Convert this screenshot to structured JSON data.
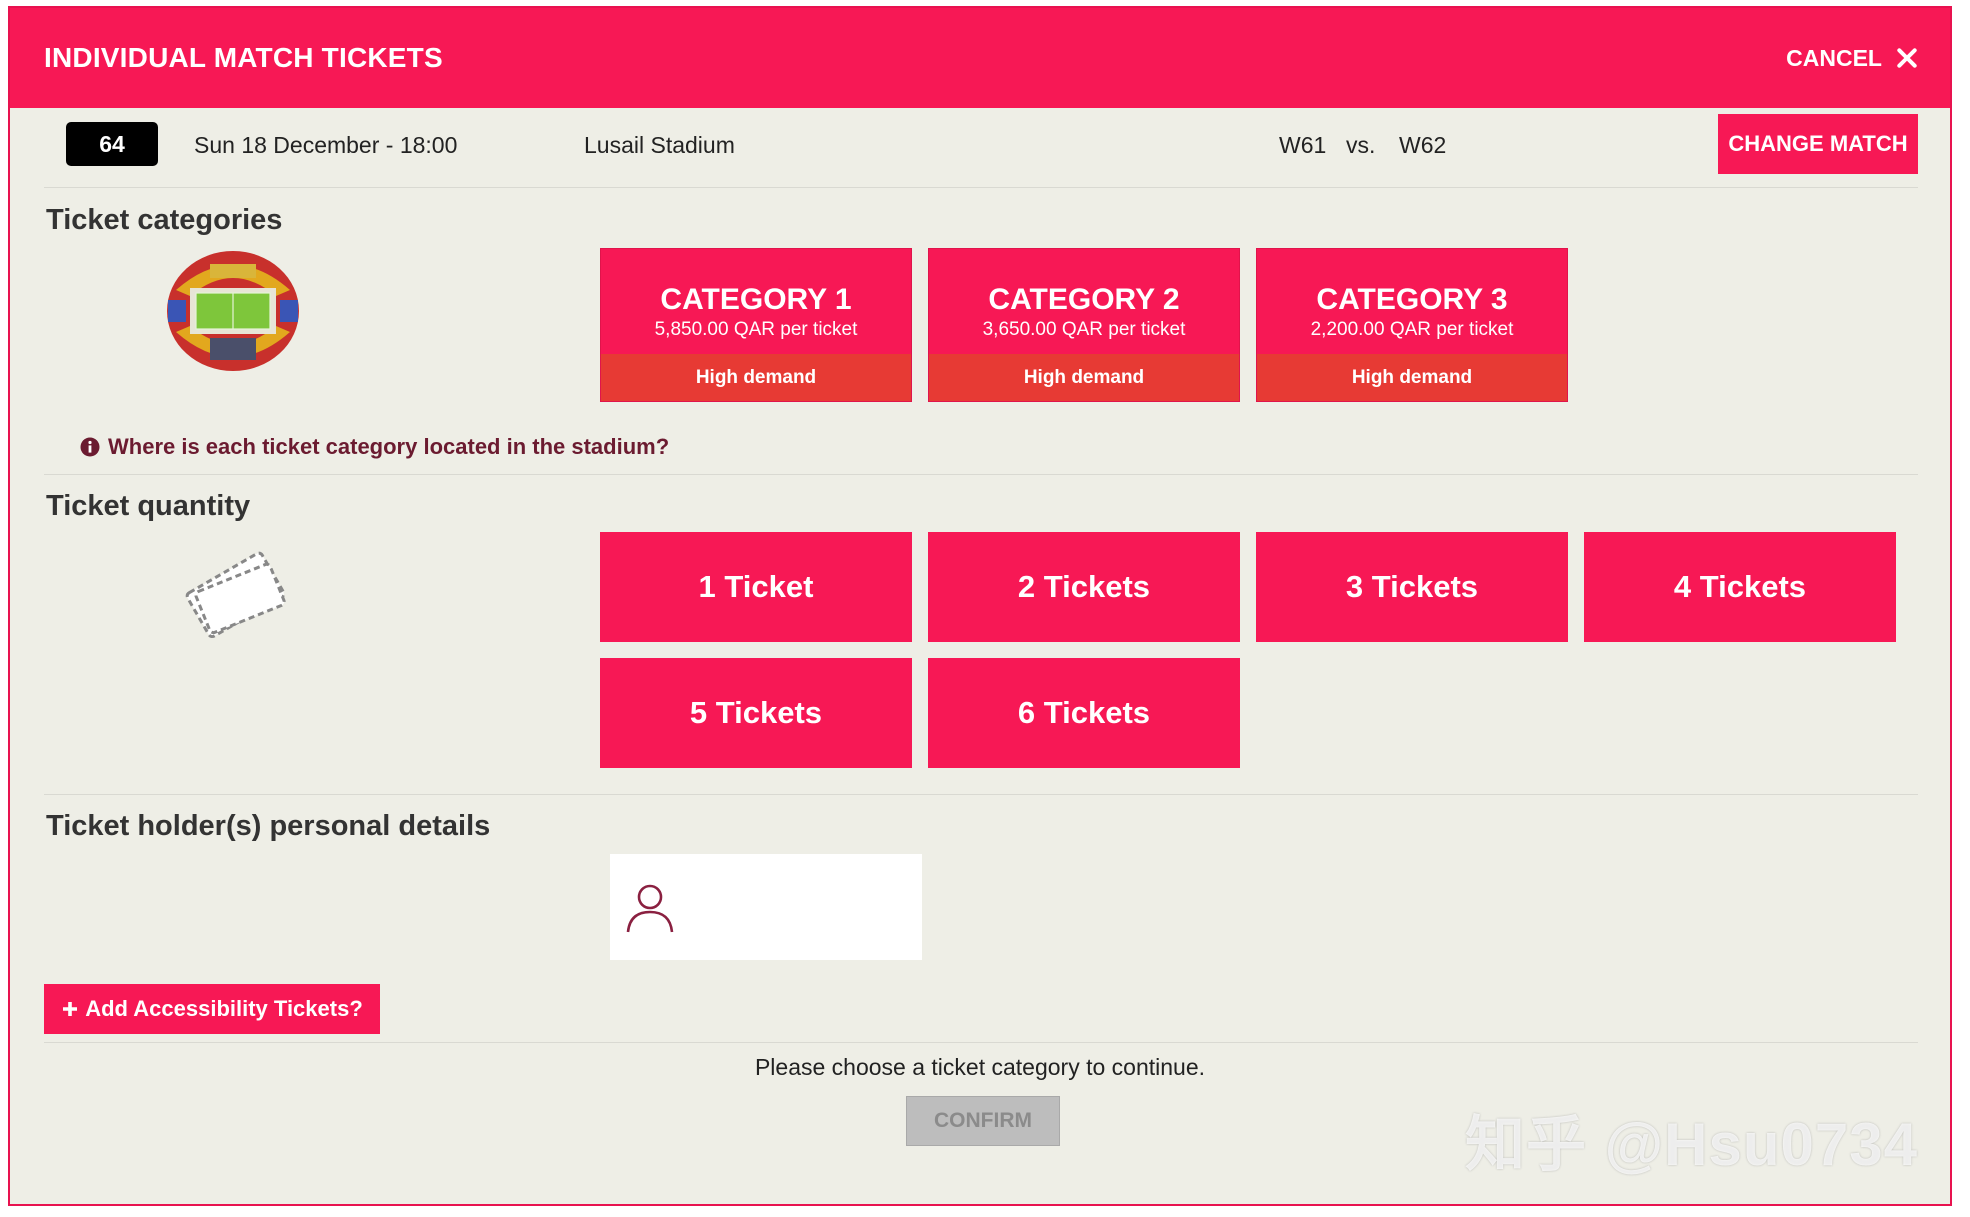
{
  "header": {
    "title": "INDIVIDUAL MATCH TICKETS",
    "cancel_label": "CANCEL"
  },
  "match": {
    "number": "64",
    "date": "Sun 18 December - 18:00",
    "venue": "Lusail Stadium",
    "home": "W61",
    "vs": "vs.",
    "away": "W62",
    "change_label": "CHANGE MATCH"
  },
  "categories": {
    "title": "Ticket categories",
    "items": [
      {
        "name": "CATEGORY 1",
        "price": "5,850.00 QAR per ticket",
        "demand": "High demand"
      },
      {
        "name": "CATEGORY 2",
        "price": "3,650.00 QAR per ticket",
        "demand": "High demand"
      },
      {
        "name": "CATEGORY 3",
        "price": "2,200.00 QAR per ticket",
        "demand": "High demand"
      }
    ],
    "where_link": "Where is each ticket category located in the stadium?"
  },
  "quantity": {
    "title": "Ticket quantity",
    "options": [
      "1 Ticket",
      "2 Tickets",
      "3 Tickets",
      "4 Tickets",
      "5 Tickets",
      "6 Tickets"
    ]
  },
  "holder": {
    "title": "Ticket holder(s) personal details"
  },
  "accessibility": {
    "label": "Add Accessibility Tickets?"
  },
  "footer": {
    "message": "Please choose a ticket category to continue.",
    "confirm_label": "CONFIRM"
  },
  "watermark": "知乎 @Hsu0734",
  "colors": {
    "brand": "#f71855",
    "demand": "#e73a34",
    "background": "#eeeee6"
  }
}
